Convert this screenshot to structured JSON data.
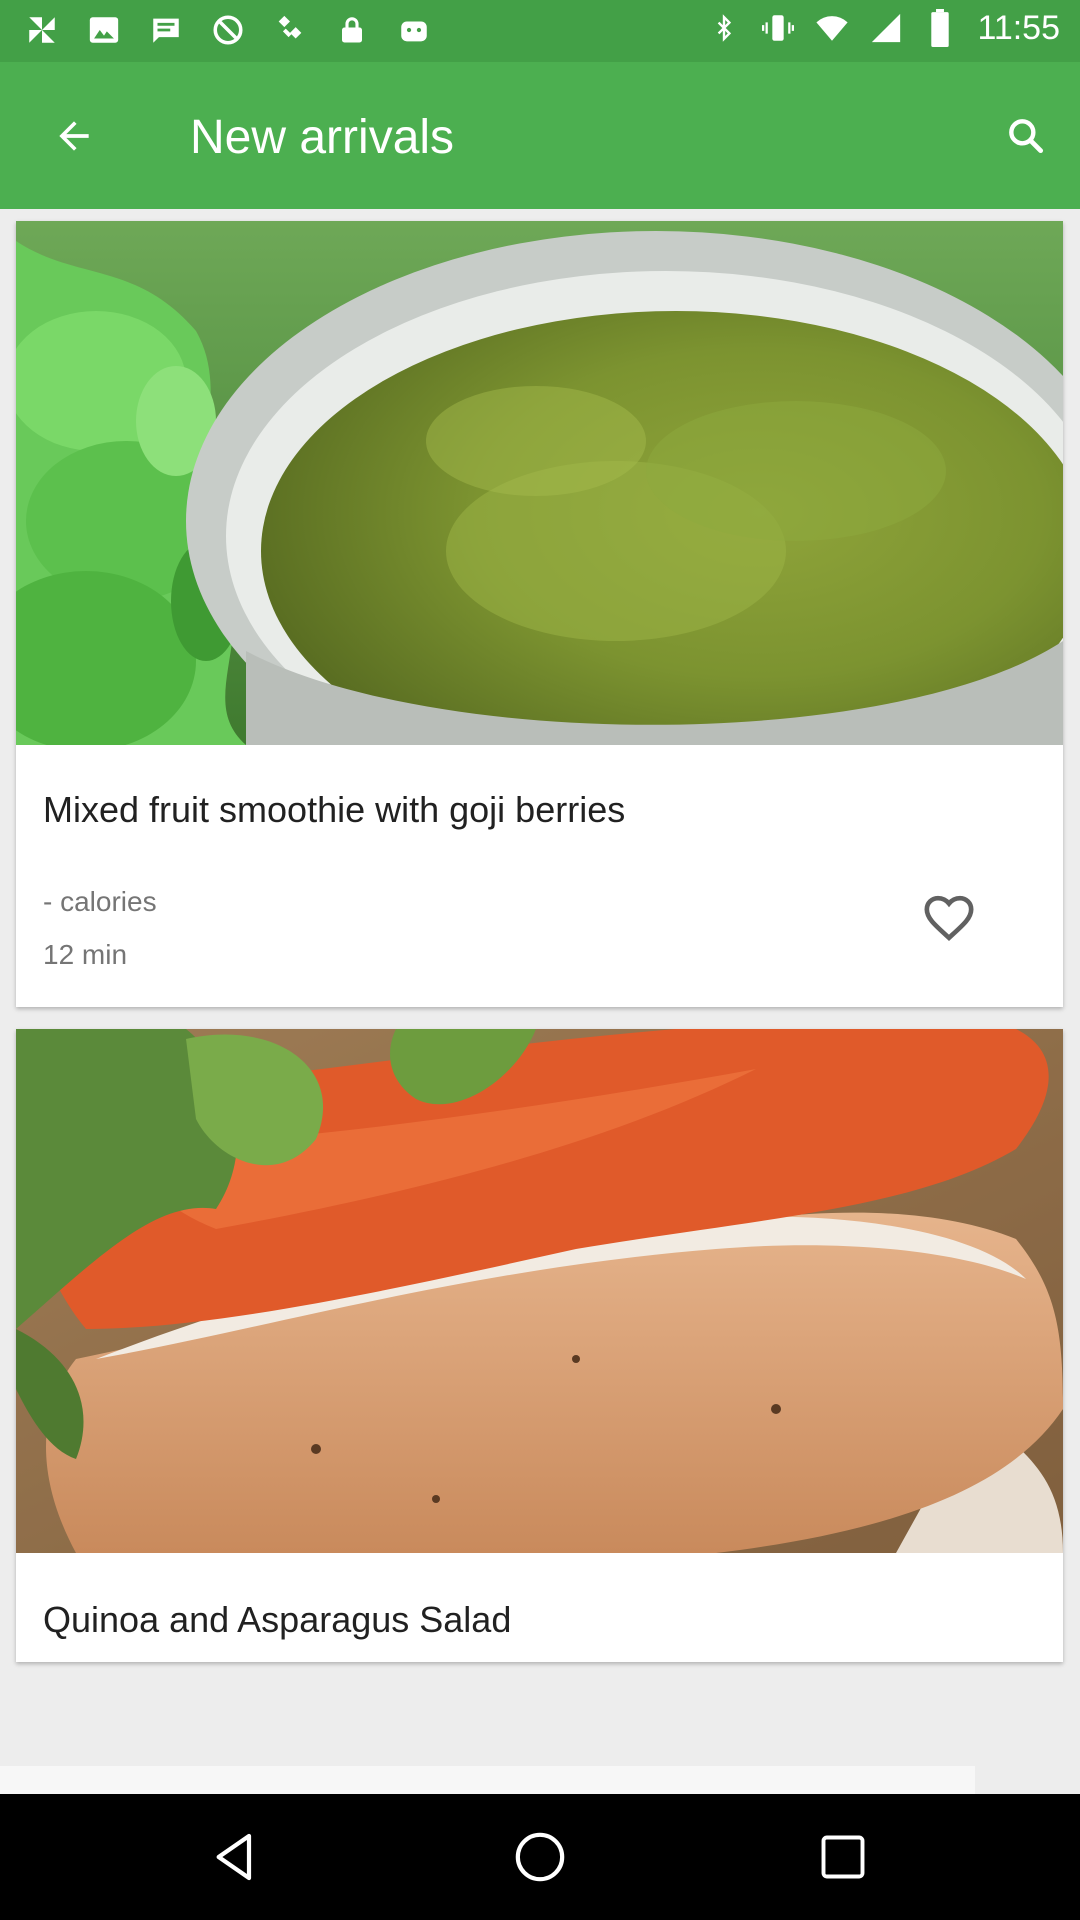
{
  "status_bar": {
    "time": "11:55",
    "left_icons": [
      "pinwheel-icon",
      "photos-icon",
      "messages-icon",
      "blocked-icon",
      "satellite-icon",
      "lock-icon",
      "android-icon"
    ],
    "right_icons": [
      "bluetooth-icon",
      "vibrate-icon",
      "wifi-icon",
      "signal-icon",
      "battery-icon"
    ]
  },
  "app_bar": {
    "title": "New arrivals",
    "back_icon": "arrow-back-icon",
    "search_icon": "search-icon",
    "color": "#4caf50",
    "status_color": "#43a047"
  },
  "recipes": [
    {
      "title": "Mixed fruit smoothie with goji berries",
      "calories": "- calories",
      "time": "12 min",
      "favorite_icon": "heart-outline-icon"
    },
    {
      "title": "Quinoa and Asparagus Salad"
    }
  ],
  "nav_bar": {
    "buttons": [
      "back-triangle-icon",
      "home-circle-icon",
      "recents-square-icon"
    ]
  }
}
